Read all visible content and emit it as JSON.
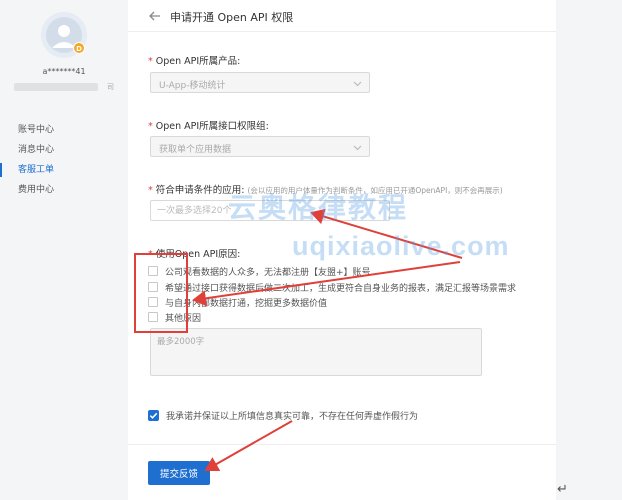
{
  "sidebar": {
    "account_name": "a*******41",
    "account_suffix": "司",
    "items": [
      {
        "label": "账号中心",
        "active": false
      },
      {
        "label": "消息中心",
        "active": false
      },
      {
        "label": "客服工单",
        "active": true
      },
      {
        "label": "费用中心",
        "active": false
      }
    ]
  },
  "header": {
    "title": "申请开通 Open API 权限"
  },
  "form": {
    "product": {
      "required_mark": "*",
      "label": "Open API所属产品:",
      "value": "U-App-移动统计"
    },
    "permission_group": {
      "required_mark": "*",
      "label": "Open API所属接口权限组:",
      "value": "获取单个应用数据"
    },
    "eligible_apps": {
      "required_mark": "*",
      "label": "符合申请条件的应用:",
      "note": "(会以应用的用户体量作为判断条件，如应用已开通OpenAPI，则不会再展示)",
      "placeholder": "一次最多选择20个"
    },
    "reason": {
      "required_mark": "*",
      "label": "使用Open API原因:",
      "options": [
        {
          "label": "公司观看数据的人众多，无法都注册【友盟+】账号",
          "checked": false
        },
        {
          "label": "希望通过接口获得数据后做二次加工，生成更符合自身业务的报表，满足汇报等场景需求",
          "checked": false
        },
        {
          "label": "与自身内部数据打通，挖掘更多数据价值",
          "checked": false
        },
        {
          "label": "其他原因",
          "checked": false
        }
      ],
      "textarea_placeholder": "最多2000字"
    },
    "agreement": {
      "label": "我承诺并保证以上所填信息真实可靠，不存在任何弄虚作假行为",
      "checked": true
    },
    "submit_label": "提交反馈"
  },
  "watermark": {
    "line1": "云奥格律教程",
    "line2": "uqixiaolive.com"
  },
  "colors": {
    "accent": "#1e6fd0",
    "required": "#e0403a",
    "annotation": "#e0403a"
  }
}
